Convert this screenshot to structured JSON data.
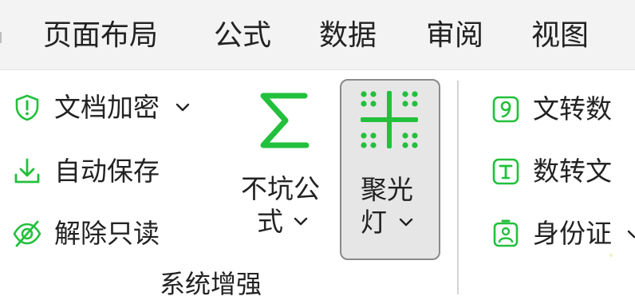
{
  "menu": {
    "items": [
      {
        "label": "页面布局"
      },
      {
        "label": "公式"
      },
      {
        "label": "数据"
      },
      {
        "label": "审阅"
      },
      {
        "label": "视图"
      }
    ]
  },
  "ribbon": {
    "left_column": [
      {
        "label": "文档加密",
        "icon": "shield-alert-icon",
        "has_dropdown": true
      },
      {
        "label": "自动保存",
        "icon": "download-icon"
      },
      {
        "label": "解除只读",
        "icon": "eye-slash-icon"
      }
    ],
    "formula_button": {
      "line1": "不坑公",
      "line2": "式",
      "icon": "sigma-icon"
    },
    "spotlight_button": {
      "line1": "聚光",
      "line2": "灯",
      "icon": "crosshair-grid-icon"
    },
    "right_column": [
      {
        "label": "文转数",
        "icon": "number-9-icon"
      },
      {
        "label": "数转文",
        "icon": "text-t-icon"
      },
      {
        "label": "身份证",
        "icon": "id-badge-icon"
      }
    ],
    "group_label": "系统增强"
  },
  "colors": {
    "accent_green": "#22c03c",
    "menubar_bg": "#f3f3f3",
    "button_selected_bg": "#e6e6e6"
  }
}
